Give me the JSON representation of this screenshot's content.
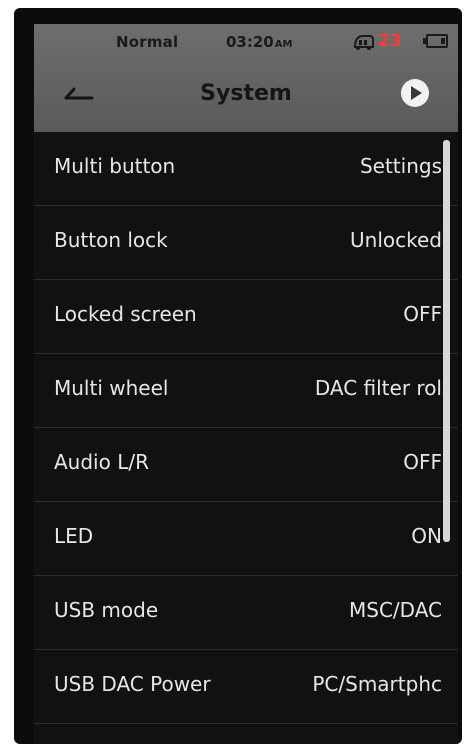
{
  "status": {
    "mode": "Normal",
    "time": "03:20",
    "ampm": "AM",
    "temperature": "23",
    "temperature_color": "#ff3b3b",
    "icons": [
      "thermometer-icon",
      "battery-icon"
    ]
  },
  "header": {
    "title": "System",
    "back_icon": "back-arrow-icon",
    "action_icon": "play-icon"
  },
  "settings": [
    {
      "label": "Multi button",
      "value": "Settings"
    },
    {
      "label": "Button lock",
      "value": "Unlocked"
    },
    {
      "label": "Locked screen",
      "value": "OFF"
    },
    {
      "label": "Multi wheel",
      "value": "DAC filter rol"
    },
    {
      "label": "Audio L/R",
      "value": "OFF"
    },
    {
      "label": "LED",
      "value": "ON"
    },
    {
      "label": "USB mode",
      "value": "MSC/DAC"
    },
    {
      "label": "USB DAC Power",
      "value": "PC/Smartphc"
    }
  ]
}
